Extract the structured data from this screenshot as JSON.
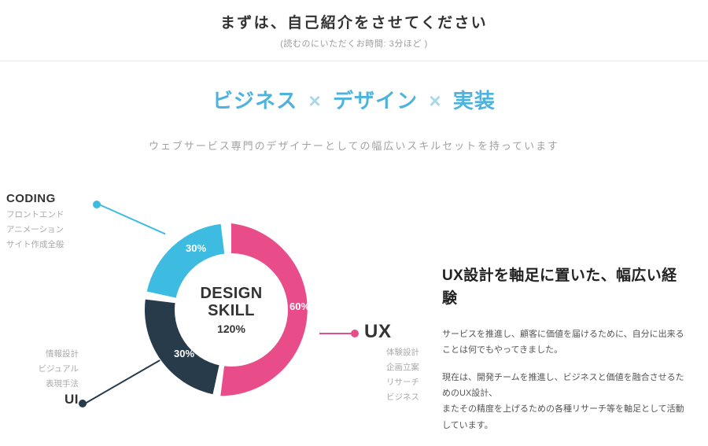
{
  "header": {
    "title": "まずは、自己紹介をさせてください",
    "reading": "(読むのにいただくお時間: 3分ほど )"
  },
  "tagline": {
    "a": "ビジネス",
    "b": "デザイン",
    "c": "実装",
    "sep": "×"
  },
  "subtag": "ウェブサービス専門のデザイナーとしての幅広いスキルセットを持っています",
  "chart_data": {
    "type": "pie",
    "title": "DESIGN SKILL",
    "total_label": "120%",
    "series": [
      {
        "name": "UX",
        "value": 60,
        "color": "#e84d8a",
        "details": [
          "体験設計",
          "企画立案",
          "リサーチ",
          "ビジネス"
        ]
      },
      {
        "name": "UI",
        "value": 30,
        "color": "#273b4b",
        "details": [
          "情報設計",
          "ビジュアル",
          "表現手法"
        ]
      },
      {
        "name": "CODING",
        "value": 30,
        "color": "#3ebbe0",
        "details": [
          "フロントエンド",
          "アニメーション",
          "サイト作成全般"
        ]
      }
    ],
    "center_title_1": "DESIGN",
    "center_title_2": "SKILL"
  },
  "percent_labels": {
    "ux": "60%",
    "ui": "30%",
    "coding": "30%"
  },
  "labels": {
    "coding": {
      "title": "CODING",
      "d0": "フロントエンド",
      "d1": "アニメーション",
      "d2": "サイト作成全般"
    },
    "ui": {
      "title": "UI",
      "d0": "情報設計",
      "d1": "ビジュアル",
      "d2": "表現手法"
    },
    "ux": {
      "title": "UX",
      "d0": "体験設計",
      "d1": "企画立案",
      "d2": "リサーチ",
      "d3": "ビジネス"
    }
  },
  "desc": {
    "heading": "UX設計を軸足に置いた、幅広い経験",
    "p1": "サービスを推進し、顧客に価値を届けるために、自分に出来ることは何でもやってきました。",
    "p2": "現在は、開発チームを推進し、ビジネスと価値を融合させるためのUX設計、",
    "p3": "またその精度を上げるための各種リサーチ等を軸足として活動しています。"
  }
}
